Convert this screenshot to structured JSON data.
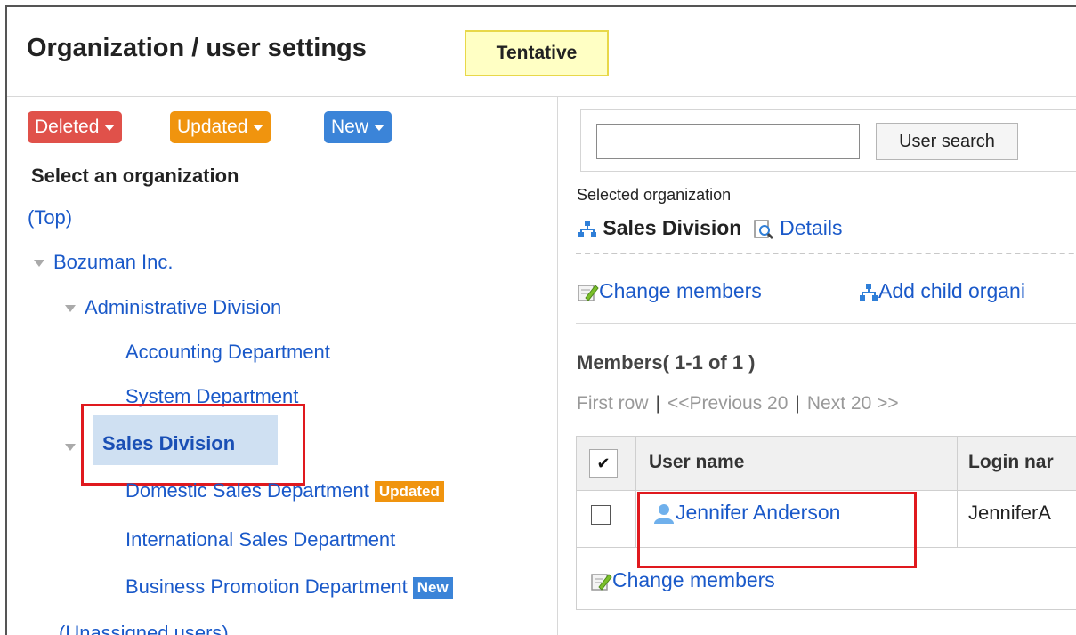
{
  "header": {
    "title": "Organization / user settings",
    "status_badge": "Tentative"
  },
  "left": {
    "filters": {
      "deleted": "Deleted",
      "updated": "Updated",
      "new": "New"
    },
    "select_heading": "Select an organization",
    "top_link": "(Top)",
    "tree": {
      "root": "Bozuman Inc.",
      "admin_division": "Administrative Division",
      "accounting": "Accounting Department",
      "system": "System Department",
      "sales_division": "Sales Division",
      "domestic": "Domestic Sales Department",
      "domestic_tag": "Updated",
      "international": "International Sales Department",
      "business": "Business Promotion Department",
      "business_tag": "New",
      "unassigned": "(Unassigned users)"
    }
  },
  "right": {
    "search": {
      "button": "User search",
      "value": ""
    },
    "selected_label": "Selected organization",
    "selected_org": "Sales Division",
    "details_link": "Details",
    "actions": {
      "change_members": "Change members",
      "add_child": "Add child organi"
    },
    "members_title": "Members( 1-1 of 1 )",
    "pager": {
      "first": "First row",
      "prev": "<<Previous 20",
      "next": "Next 20 >>"
    },
    "table": {
      "headers": {
        "check": "✔",
        "user_name": "User name",
        "login_name": "Login nar"
      },
      "rows": [
        {
          "user_name": "Jennifer Anderson",
          "login_name": "JenniferA"
        }
      ]
    },
    "bottom_change_members": "Change members"
  },
  "colors": {
    "deleted": "#e0514a",
    "updated": "#f0940e",
    "new": "#3b84d8",
    "link": "#1a59c9",
    "highlight": "#e0191e"
  }
}
